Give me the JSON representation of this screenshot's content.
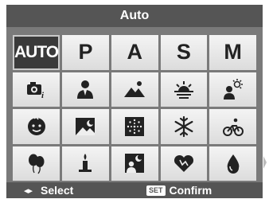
{
  "title": "Auto",
  "modes": {
    "auto": "AUTO",
    "p": "P",
    "a": "A",
    "s": "S",
    "m": "M"
  },
  "footer": {
    "select_arrows": "◂▸",
    "select_label": "Select",
    "set_badge": "SET",
    "confirm_label": "Confirm"
  },
  "colors": {
    "screen_bg": "#7a7a7a",
    "bar_bg": "#555555",
    "cell_bg": "#e8e8e8",
    "selected_bg": "#3a3a3a"
  }
}
